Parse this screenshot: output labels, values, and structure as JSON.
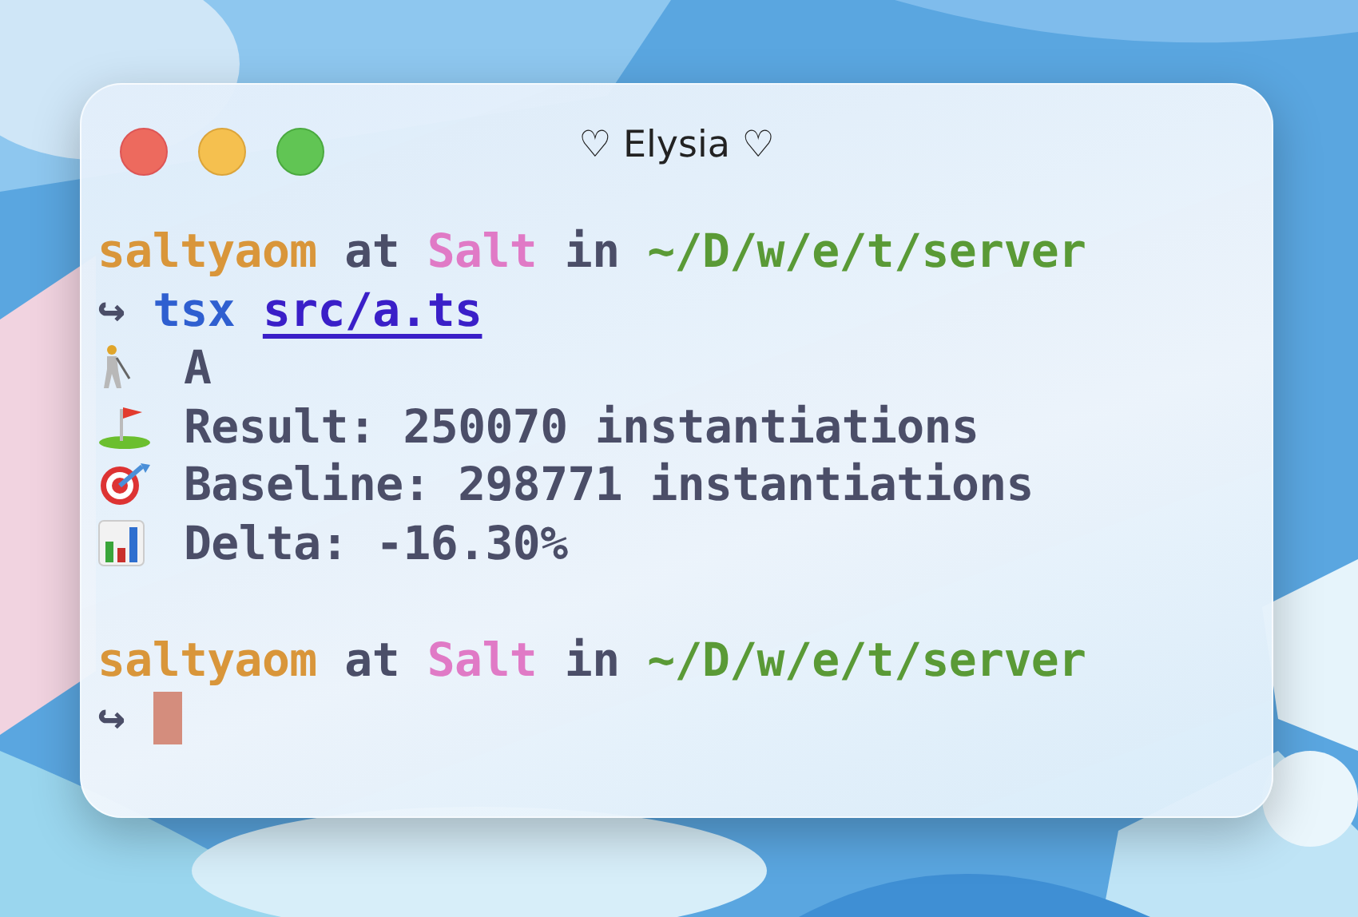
{
  "window": {
    "title": "♡ Elysia ♡"
  },
  "lines": [
    {
      "kind": "prompt",
      "user": "saltyaom",
      "at": "at",
      "host": "Salt",
      "in": "in",
      "path": "~/D/w/e/t/server"
    },
    {
      "kind": "command",
      "arrow": "↪",
      "command": "tsx",
      "argument": "src/a.ts"
    },
    {
      "kind": "output",
      "text": "A"
    },
    {
      "kind": "output",
      "text": "Result: 250070 instantiations"
    },
    {
      "kind": "output",
      "text": "Baseline: 298771 instantiations"
    },
    {
      "kind": "output",
      "text": "Delta: -16.30%"
    },
    {
      "kind": "blank"
    },
    {
      "kind": "prompt",
      "user": "saltyaom",
      "at": "at",
      "host": "Salt",
      "in": "in",
      "path": "~/D/w/e/t/server"
    },
    {
      "kind": "input",
      "arrow": "↪",
      "cursor": true
    }
  ]
}
